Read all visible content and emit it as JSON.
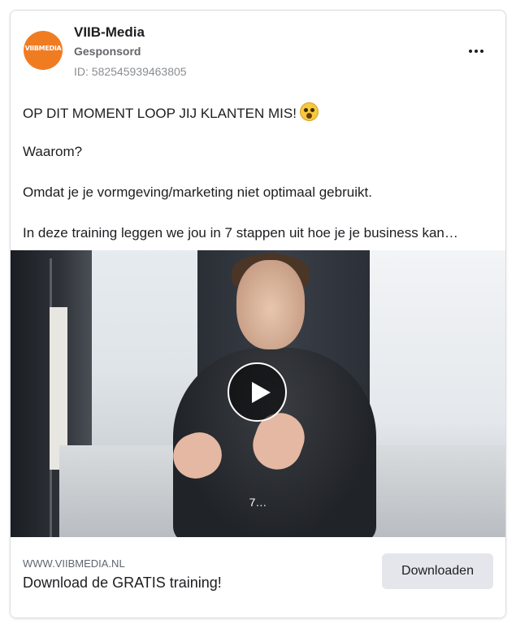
{
  "ad": {
    "page_name": "VIIB-Media",
    "avatar_text": "VIIBMEDIA",
    "sponsored_label": "Gesponsord",
    "ad_id": "ID: 582545939463805",
    "more_icon": "more-horizontal-icon",
    "body_lines": [
      "OP DIT MOMENT LOOP JIJ KLANTEN MIS!",
      "Waarom?",
      "Omdat je je vormgeving/marketing niet optimaal gebruikt.",
      "In deze training leggen we jou in 7 stappen uit hoe je je business kan…"
    ],
    "emoji_icon": "scream-emoji-icon",
    "video": {
      "play_icon": "play-icon",
      "caption": "7…"
    },
    "footer": {
      "domain": "WWW.VIIBMEDIA.NL",
      "headline": "Download de GRATIS training!",
      "cta_label": "Downloaden"
    },
    "colors": {
      "brand": "#f07c22",
      "cta_bg": "#e4e6eb",
      "border": "#dadde1"
    }
  }
}
